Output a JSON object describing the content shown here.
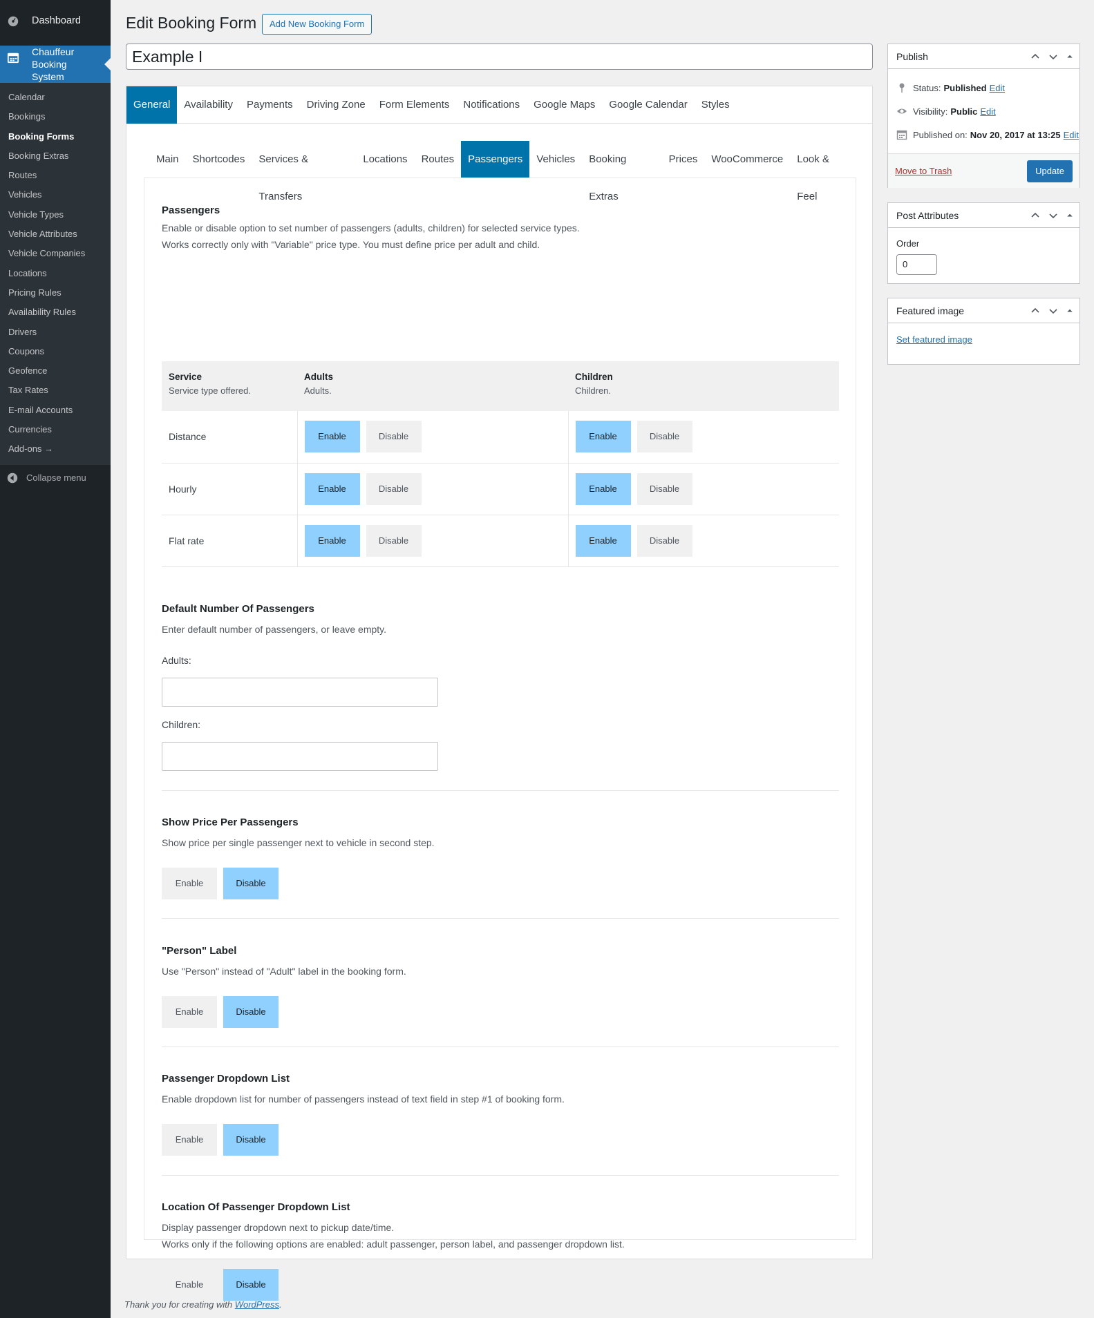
{
  "sidebar": {
    "dashboard": "Dashboard",
    "current": "Chauffeur Booking System",
    "items": [
      {
        "label": "Calendar"
      },
      {
        "label": "Bookings"
      },
      {
        "label": "Booking Forms"
      },
      {
        "label": "Booking Extras"
      },
      {
        "label": "Routes"
      },
      {
        "label": "Vehicles"
      },
      {
        "label": "Vehicle Types"
      },
      {
        "label": "Vehicle Attributes"
      },
      {
        "label": "Vehicle Companies"
      },
      {
        "label": "Locations"
      },
      {
        "label": "Pricing Rules"
      },
      {
        "label": "Availability Rules"
      },
      {
        "label": "Drivers"
      },
      {
        "label": "Coupons"
      },
      {
        "label": "Geofence"
      },
      {
        "label": "Tax Rates"
      },
      {
        "label": "E-mail Accounts"
      },
      {
        "label": "Currencies"
      },
      {
        "label": "Add-ons →"
      }
    ],
    "active_index": 2,
    "collapse": "Collapse menu"
  },
  "header": {
    "title": "Edit Booking Form",
    "add_new": "Add New Booking Form",
    "post_title": "Example I"
  },
  "main_tabs": [
    "General",
    "Availability",
    "Payments",
    "Driving Zone",
    "Form Elements",
    "Notifications",
    "Google Maps",
    "Google Calendar",
    "Styles"
  ],
  "main_tab_active": 0,
  "sub_tabs": [
    "Main",
    "Shortcodes",
    "Services & Transfers",
    "Locations",
    "Routes",
    "Passengers",
    "Vehicles",
    "Booking Extras",
    "Prices",
    "WooCommerce",
    "Look & Feel"
  ],
  "sub_tab_active": 5,
  "passengers": {
    "title": "Passengers",
    "desc1": "Enable or disable option to set number of passengers (adults, children) for selected service types.",
    "desc2": "Works correctly only with \"Variable\" price type. You must define price per adult and child.",
    "columns": [
      {
        "title": "Service",
        "sub": "Service type offered."
      },
      {
        "title": "Adults",
        "sub": "Adults."
      },
      {
        "title": "Children",
        "sub": "Children."
      }
    ],
    "rows": [
      {
        "service": "Distance",
        "adults": "Enable",
        "children": "Enable"
      },
      {
        "service": "Hourly",
        "adults": "Enable",
        "children": "Enable"
      },
      {
        "service": "Flat rate",
        "adults": "Enable",
        "children": "Enable"
      }
    ]
  },
  "buttons": {
    "enable": "Enable",
    "disable": "Disable"
  },
  "default_passengers": {
    "title": "Default Number Of Passengers",
    "desc": "Enter default number of passengers, or leave empty.",
    "adults_label": "Adults:",
    "adults_value": "",
    "children_label": "Children:",
    "children_value": ""
  },
  "show_price": {
    "title": "Show Price Per Passengers",
    "desc": "Show price per single passenger next to vehicle in second step.",
    "value": "Disable"
  },
  "person_label": {
    "title": "\"Person\" Label",
    "desc": "Use \"Person\" instead of \"Adult\" label in the booking form.",
    "value": "Disable"
  },
  "dropdown": {
    "title": "Passenger Dropdown List",
    "desc": "Enable dropdown list for number of passengers instead of text field in step #1 of booking form.",
    "value": "Disable"
  },
  "dropdown_location": {
    "title": "Location Of Passenger Dropdown List",
    "desc1": "Display passenger dropdown next to pickup date/time.",
    "desc2": "Works only if the following options are enabled: adult passenger, person label, and passenger dropdown list.",
    "value": "Disable"
  },
  "publish": {
    "title": "Publish",
    "status_label": "Status:",
    "status_value": "Published",
    "visibility_label": "Visibility:",
    "visibility_value": "Public",
    "published_label": "Published on:",
    "published_value": "Nov 20, 2017 at 13:25",
    "edit": "Edit",
    "trash": "Move to Trash",
    "update": "Update"
  },
  "attributes": {
    "title": "Post Attributes",
    "order_label": "Order",
    "order_value": "0"
  },
  "featured": {
    "title": "Featured image",
    "link": "Set featured image"
  },
  "footer": {
    "text": "Thank you for creating with ",
    "link": "WordPress",
    "end": "."
  }
}
